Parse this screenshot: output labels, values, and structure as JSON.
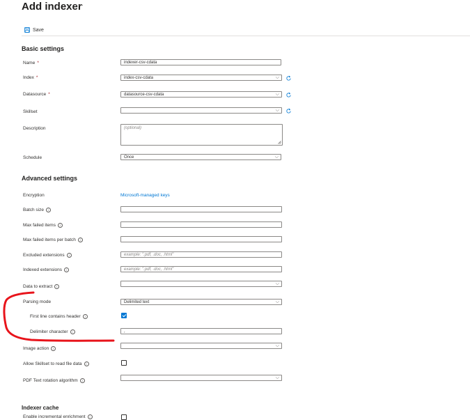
{
  "header": {
    "title": "Add indexer",
    "more": "···"
  },
  "toolbar": {
    "save_label": "Save"
  },
  "basic": {
    "heading": "Basic settings",
    "name_label": "Name",
    "name_value": "indexer-csv-cdata",
    "index_label": "Index",
    "index_value": "index-csv-cdata",
    "datasource_label": "Datasource",
    "datasource_value": "datasource-csv-cdata",
    "skillset_label": "Skillset",
    "skillset_value": "",
    "description_label": "Description",
    "description_placeholder": "(optional)",
    "schedule_label": "Schedule",
    "schedule_value": "Once",
    "required_mark": "*"
  },
  "advanced": {
    "heading": "Advanced settings",
    "encryption_label": "Encryption",
    "encryption_link": "Microsoft-managed keys",
    "batch_size_label": "Batch size",
    "max_failed_label": "Max failed items",
    "max_failed_batch_label": "Max failed items per batch",
    "excluded_label": "Excluded extensions",
    "excluded_placeholder": "example: \".pdf, .doc, .html\"",
    "indexed_label": "Indexed extensions",
    "indexed_placeholder": "example: \".pdf, .doc, .html\"",
    "data_extract_label": "Data to extract",
    "parsing_label": "Parsing mode",
    "parsing_value": "Delimited text",
    "first_line_label": "First line contains header",
    "first_line_checked": true,
    "delimiter_label": "Delimiter character",
    "delimiter_value": ",",
    "image_action_label": "Image action",
    "allow_skillset_label": "Allow Skillset to read file data",
    "allow_skillset_checked": false,
    "pdf_rotation_label": "PDF Text rotation algorithm"
  },
  "cache": {
    "heading": "Indexer cache",
    "incremental_label": "Enable incremental enrichment"
  },
  "icons": {
    "info": "i",
    "chevron": "⌵"
  },
  "colors": {
    "accent": "#0078d4",
    "annotation": "#e8141b",
    "required": "#a4262c"
  }
}
